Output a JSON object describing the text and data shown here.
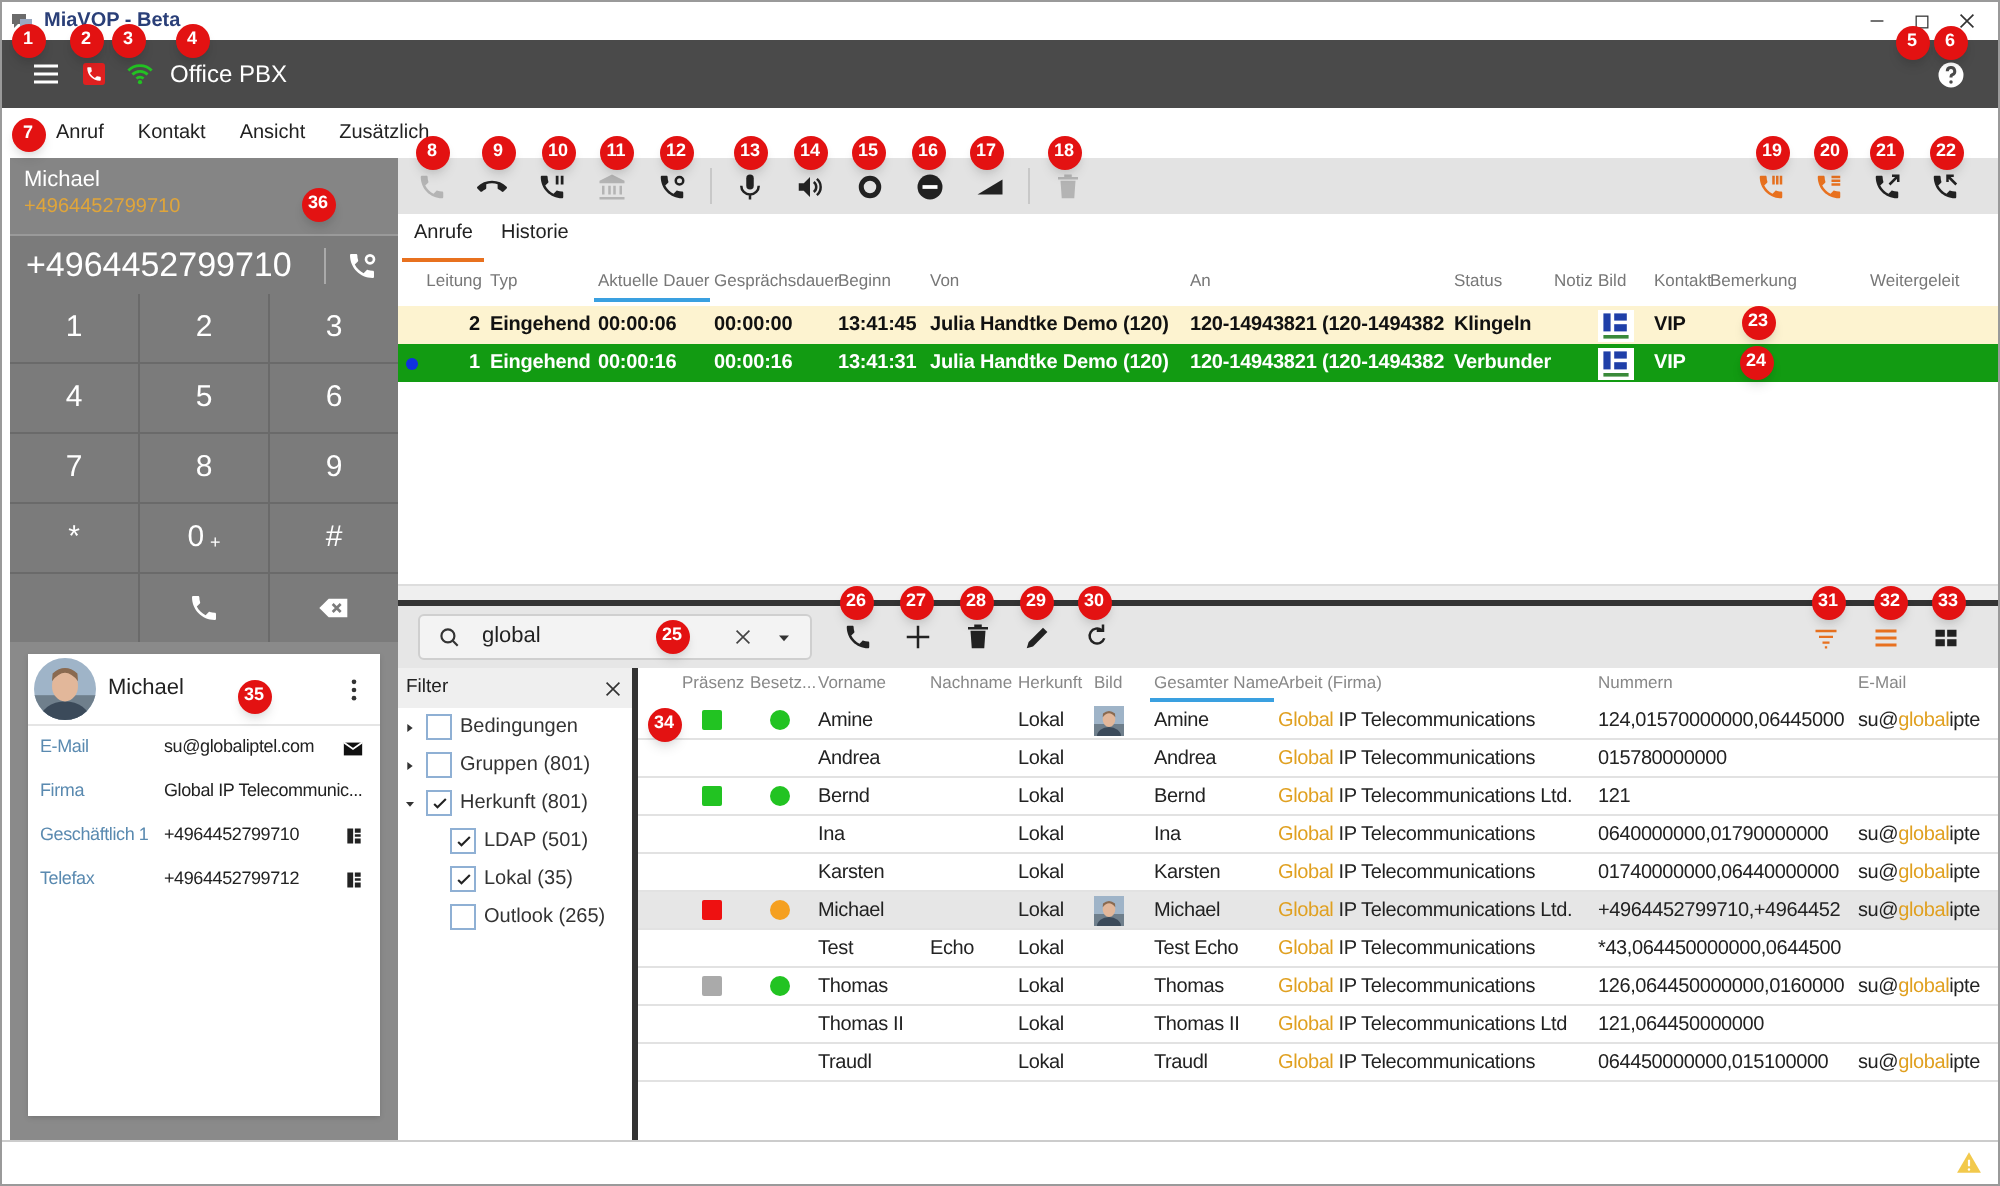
{
  "window": {
    "title": "MiaVOP - Beta"
  },
  "header": {
    "title": "Office PBX"
  },
  "menu": [
    "Anruf",
    "Kontakt",
    "Ansicht",
    "Zusätzlich"
  ],
  "call_toolbar": {
    "groups": [
      [
        {
          "kind": "call",
          "disabled": true
        },
        {
          "kind": "hangup",
          "disabled": false
        },
        {
          "kind": "hold",
          "disabled": false
        },
        {
          "kind": "building",
          "disabled": true
        },
        {
          "kind": "forward",
          "disabled": false
        }
      ],
      [
        {
          "kind": "mic",
          "disabled": false
        },
        {
          "kind": "speaker",
          "disabled": false
        },
        {
          "kind": "record",
          "disabled": false
        },
        {
          "kind": "block",
          "disabled": false
        },
        {
          "kind": "volume",
          "disabled": false
        }
      ],
      [
        {
          "kind": "trash",
          "disabled": true
        }
      ]
    ],
    "right": [
      {
        "kind": "conf1",
        "color": "#e8711f"
      },
      {
        "kind": "conf2",
        "color": "#e8711f"
      },
      {
        "kind": "merge",
        "color": "#222222"
      },
      {
        "kind": "split",
        "color": "#222222"
      }
    ]
  },
  "current_call": {
    "name": "Michael",
    "number": "+4964452799710"
  },
  "dial": {
    "number": "+4964452799710",
    "keys": [
      {
        "kind": "digit",
        "label": "1"
      },
      {
        "kind": "digit",
        "label": "2"
      },
      {
        "kind": "digit",
        "label": "3"
      },
      {
        "kind": "digit",
        "label": "4"
      },
      {
        "kind": "digit",
        "label": "5"
      },
      {
        "kind": "digit",
        "label": "6"
      },
      {
        "kind": "digit",
        "label": "7"
      },
      {
        "kind": "digit",
        "label": "8"
      },
      {
        "kind": "digit",
        "label": "9"
      },
      {
        "kind": "digit",
        "label": "*"
      },
      {
        "kind": "digit",
        "label": "0",
        "sub": "+"
      },
      {
        "kind": "digit",
        "label": "#"
      },
      {
        "kind": "blank"
      },
      {
        "kind": "call"
      },
      {
        "kind": "backspace"
      }
    ]
  },
  "tabs": [
    {
      "label": "Anrufe",
      "selected": true
    },
    {
      "label": "Historie",
      "selected": false
    }
  ],
  "calls": {
    "columns": [
      {
        "label": "Leitung",
        "sorted": false
      },
      {
        "label": "Typ",
        "sorted": false
      },
      {
        "label": "Aktuelle Dauer",
        "sorted": true
      },
      {
        "label": "Gesprächsdauer",
        "sorted": false
      },
      {
        "label": "Beginn",
        "sorted": false
      },
      {
        "label": "Von",
        "sorted": false
      },
      {
        "label": "An",
        "sorted": false
      },
      {
        "label": "Status",
        "sorted": false
      },
      {
        "label": "Notiz",
        "sorted": false
      },
      {
        "label": "Bild",
        "sorted": false
      },
      {
        "label": "Kontakt",
        "sorted": false
      },
      {
        "label": "Bemerkung",
        "sorted": false
      },
      {
        "label": "Weitergeleit",
        "sorted": false
      }
    ],
    "rows": [
      {
        "color": "#fdf3d0",
        "selected": false,
        "line": "2",
        "type": "Eingehend",
        "current": "00:00:06",
        "duration": "00:00:00",
        "start": "13:41:45",
        "from": "Julia Handtke Demo (120)",
        "to": "120-14943821 (120-1494382",
        "status": "Klingeln",
        "contact": "VIP"
      },
      {
        "color": "#129b12",
        "selected": true,
        "line": "1",
        "type": "Eingehend",
        "current": "00:00:16",
        "duration": "00:00:16",
        "start": "13:41:31",
        "from": "Julia Handtke Demo (120)",
        "to": "120-14943821 (120-1494382",
        "status": "Verbunder",
        "contact": "VIP"
      }
    ]
  },
  "contact_search": {
    "value": "global"
  },
  "contact_toolbar": {
    "left": [
      {
        "kind": "call"
      },
      {
        "kind": "add"
      },
      {
        "kind": "trash"
      },
      {
        "kind": "edit"
      },
      {
        "kind": "refresh"
      }
    ],
    "right": [
      {
        "kind": "filter",
        "color": "#e8711f"
      },
      {
        "kind": "list",
        "color": "#e8711f"
      },
      {
        "kind": "grid",
        "color": "#222222"
      }
    ]
  },
  "filter": {
    "title": "Filter",
    "items": [
      {
        "label": "Bedingungen",
        "checked": false,
        "expanded": false
      },
      {
        "label": "Gruppen (801)",
        "checked": false,
        "expanded": false
      },
      {
        "label": "Herkunft (801)",
        "checked": true,
        "expanded": true,
        "children": [
          {
            "label": "LDAP (501)",
            "checked": true
          },
          {
            "label": "Lokal (35)",
            "checked": true
          },
          {
            "label": "Outlook (265)",
            "checked": false
          }
        ]
      }
    ]
  },
  "contacts": {
    "columns": [
      {
        "label": "Präsenz",
        "sorted": false
      },
      {
        "label": "Besetz...",
        "sorted": false
      },
      {
        "label": "Vorname",
        "sorted": false
      },
      {
        "label": "Nachname",
        "sorted": false
      },
      {
        "label": "Herkunft",
        "sorted": false
      },
      {
        "label": "Bild",
        "sorted": false
      },
      {
        "label": "Gesamter Name",
        "sorted": true
      },
      {
        "label": "Arbeit (Firma)",
        "sorted": false
      },
      {
        "label": "Nummern",
        "sorted": false
      },
      {
        "label": "E-Mail",
        "sorted": false
      }
    ],
    "rows": [
      {
        "selected": false,
        "presence": {
          "color": "#22c322"
        },
        "busy": {
          "color": "#22c322"
        },
        "first": "Amine",
        "origin": "Lokal",
        "photo": true,
        "full": "Amine",
        "company": {
          "match": "Global",
          "rest": "IP Telecommunications"
        },
        "numbers": "124,01570000000,06445000",
        "email": {
          "user": "su@",
          "match": "global",
          "rest": "ipte"
        }
      },
      {
        "selected": false,
        "first": "Andrea",
        "origin": "Lokal",
        "photo": false,
        "full": "Andrea",
        "company": {
          "match": "Global",
          "rest": "IP Telecommunications"
        },
        "numbers": "015780000000"
      },
      {
        "selected": false,
        "presence": {
          "color": "#22c322"
        },
        "busy": {
          "color": "#22c322"
        },
        "first": "Bernd",
        "origin": "Lokal",
        "photo": false,
        "full": "Bernd",
        "company": {
          "match": "Global",
          "rest": "IP Telecommunications Ltd."
        },
        "numbers": "121"
      },
      {
        "selected": false,
        "first": "Ina",
        "origin": "Lokal",
        "photo": false,
        "full": "Ina",
        "company": {
          "match": "Global",
          "rest": "IP Telecommunications"
        },
        "numbers": "0640000000,01790000000",
        "email": {
          "user": "su@",
          "match": "global",
          "rest": "ipte"
        }
      },
      {
        "selected": false,
        "first": "Karsten",
        "origin": "Lokal",
        "photo": false,
        "full": "Karsten",
        "company": {
          "match": "Global",
          "rest": "IP Telecommunications"
        },
        "numbers": "01740000000,06440000000",
        "email": {
          "user": "su@",
          "match": "global",
          "rest": "ipte"
        }
      },
      {
        "selected": true,
        "presence": {
          "color": "#ee1111"
        },
        "busy": {
          "color": "#f5a020"
        },
        "first": "Michael",
        "origin": "Lokal",
        "photo": true,
        "full": "Michael",
        "company": {
          "match": "Global",
          "rest": "IP Telecommunications Ltd."
        },
        "numbers": "+4964452799710,+4964452",
        "email": {
          "user": "su@",
          "match": "global",
          "rest": "ipte"
        }
      },
      {
        "selected": false,
        "first": "Test",
        "last": "Echo",
        "origin": "Lokal",
        "photo": false,
        "full": "Test Echo",
        "company": {
          "match": "Global",
          "rest": "IP Telecommunications"
        },
        "numbers": "*43,064450000000,0644500"
      },
      {
        "selected": false,
        "presence": {
          "color": "#aaaaaa"
        },
        "busy": {
          "color": "#22c322"
        },
        "first": "Thomas",
        "origin": "Lokal",
        "photo": false,
        "full": "Thomas",
        "company": {
          "match": "Global",
          "rest": "IP Telecommunications"
        },
        "numbers": "126,064450000000,0160000",
        "email": {
          "user": "su@",
          "match": "global",
          "rest": "ipte"
        }
      },
      {
        "selected": false,
        "first": "Thomas II",
        "origin": "Lokal",
        "photo": false,
        "full": "Thomas II",
        "company": {
          "match": "Global",
          "rest": "IP Telecommunications Ltd"
        },
        "numbers": "121,064450000000"
      },
      {
        "selected": false,
        "first": "Traudl",
        "origin": "Lokal",
        "photo": false,
        "full": "Traudl",
        "company": {
          "match": "Global",
          "rest": "IP Telecommunications"
        },
        "numbers": "064450000000,015100000",
        "email": {
          "user": "su@",
          "match": "global",
          "rest": "ipte"
        }
      }
    ]
  },
  "contact_card": {
    "name": "Michael",
    "fields": [
      {
        "label": "E-Mail",
        "value": "su@globaliptel.com",
        "kind": "mail"
      },
      {
        "label": "Firma",
        "value": "Global IP Telecommunic...",
        "kind": "text"
      },
      {
        "label": "Geschäftlich 1",
        "value": "+4964452799710",
        "kind": "phone"
      },
      {
        "label": "Telefax",
        "value": "+4964452799712",
        "kind": "phone"
      }
    ]
  },
  "callouts": [
    "1",
    "2",
    "3",
    "4",
    "5",
    "6",
    "7",
    "8",
    "9",
    "10",
    "11",
    "12",
    "13",
    "14",
    "15",
    "16",
    "17",
    "18",
    "19",
    "20",
    "21",
    "22",
    "23",
    "24",
    "25",
    "26",
    "27",
    "28",
    "29",
    "30",
    "31",
    "32",
    "33",
    "34",
    "35",
    "36"
  ]
}
